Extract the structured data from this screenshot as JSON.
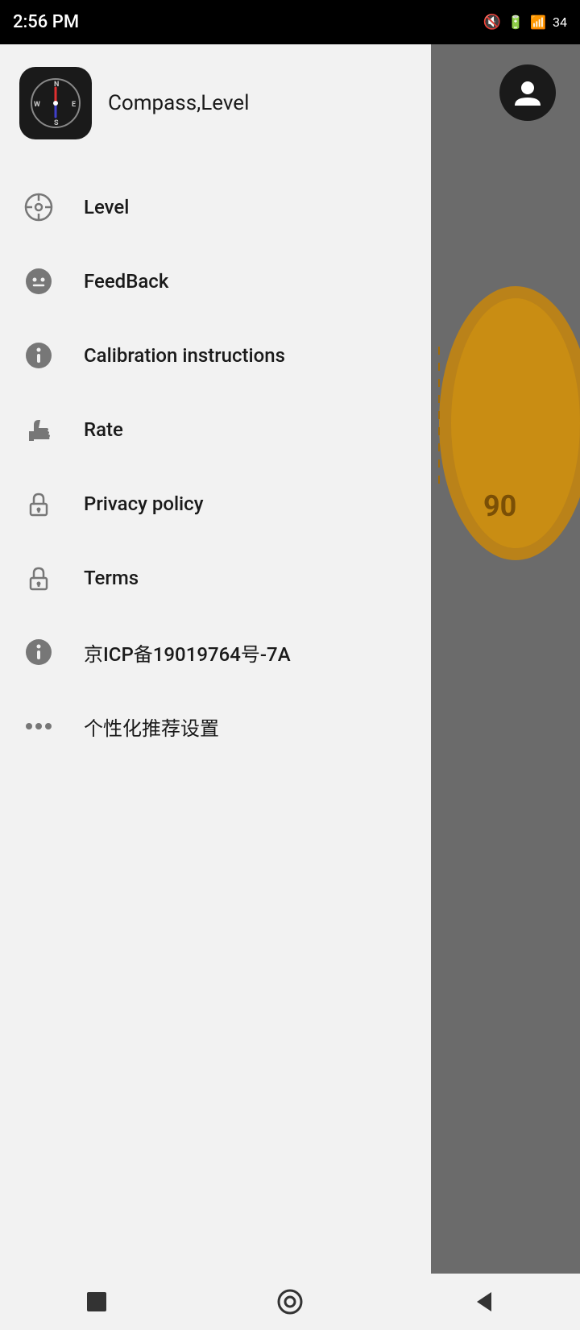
{
  "statusBar": {
    "time": "2:56 PM",
    "batteryLevel": "34"
  },
  "app": {
    "title": "Compass,Level"
  },
  "menuItems": [
    {
      "id": "level",
      "label": "Level",
      "icon": "crosshair-icon"
    },
    {
      "id": "feedback",
      "label": "FeedBack",
      "icon": "ghost-icon"
    },
    {
      "id": "calibration",
      "label": "Calibration instructions",
      "icon": "info-circle-icon"
    },
    {
      "id": "rate",
      "label": "Rate",
      "icon": "thumbs-up-icon"
    },
    {
      "id": "privacy",
      "label": "Privacy policy",
      "icon": "lock-icon"
    },
    {
      "id": "terms",
      "label": "Terms",
      "icon": "lock2-icon"
    },
    {
      "id": "icp",
      "label": "京ICP备19019764号-7A",
      "icon": "info-circle2-icon"
    },
    {
      "id": "personalized",
      "label": "个性化推荐设置",
      "icon": "dots-icon"
    }
  ],
  "navBar": {
    "squareLabel": "■",
    "circleLabel": "⊙",
    "triangleLabel": "◁"
  }
}
